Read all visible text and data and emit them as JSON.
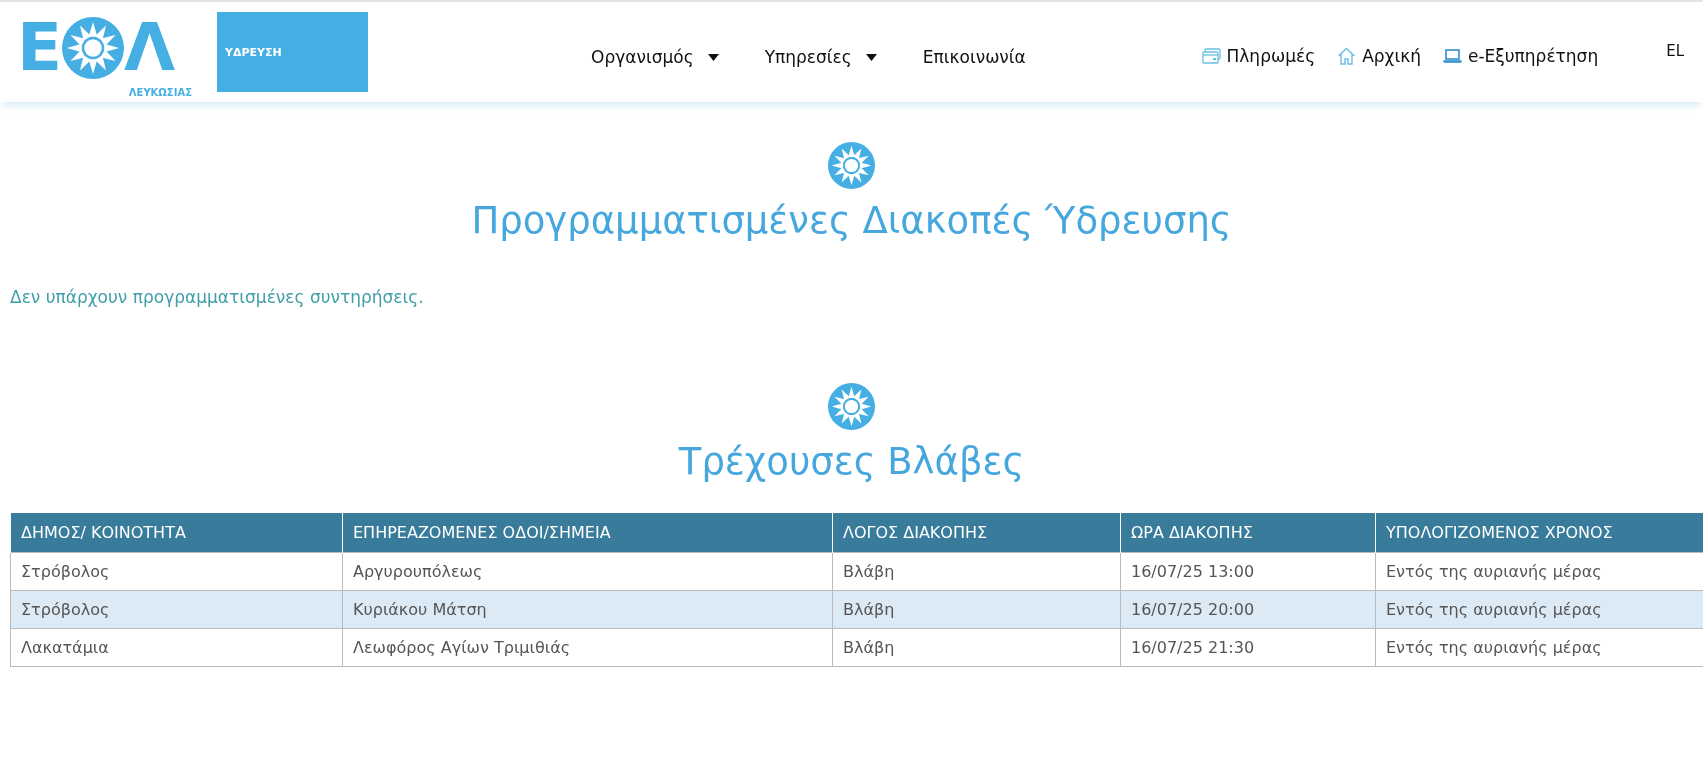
{
  "logo": {
    "letters": [
      "Ε",
      "Λ"
    ],
    "subtitle": "ΛΕΥΚΩΣΙΑΣ"
  },
  "section_badge": "ΥΔΡΕΥΣΗ",
  "nav": [
    {
      "label": "Οργανισμός",
      "dropdown": true
    },
    {
      "label": "Υπηρεσίες",
      "dropdown": true
    },
    {
      "label": "Επικοινωνία",
      "dropdown": false
    }
  ],
  "quick_links": [
    {
      "label": "Πληρωμές",
      "kind": "card"
    },
    {
      "label": "Αρχική",
      "kind": "home"
    },
    {
      "label": "e-Εξυπηρέτηση",
      "kind": "laptop"
    }
  ],
  "language": "EL",
  "planned": {
    "title": "Προγραμματισμένες Διακοπές Ύδρευσης",
    "message": "Δεν υπάρχουν προγραμματισμένες συντηρήσεις."
  },
  "faults": {
    "title": "Τρέχουσες Βλάβες",
    "table": {
      "columns": [
        "ΔΗΜΟΣ/ ΚΟΙΝΟΤΗΤΑ",
        "ΕΠΗΡΕΑΖΟΜΕΝΕΣ ΟΔΟΙ/ΣΗΜΕΙΑ",
        "ΛΟΓΟΣ ΔΙΑΚΟΠΗΣ",
        "ΩΡΑ ΔΙΑΚΟΠΗΣ",
        "ΥΠΟΛΟΓΙΖΟΜΕΝΟΣ ΧΡΟΝΟΣ"
      ],
      "rows": [
        [
          "Στρόβολος",
          "Αργυρουπόλεως",
          "Βλάβη",
          "16/07/25 13:00",
          "Εντός της αυριανής μέρας"
        ],
        [
          "Στρόβολος",
          "Κυριάκου Μάτση",
          "Βλάβη",
          "16/07/25 20:00",
          "Εντός της αυριανής μέρας"
        ],
        [
          "Λακατάμια",
          "Λεωφόρος Αγίων Τριμιθιάς",
          "Βλάβη",
          "16/07/25 21:30",
          "Εντός της αυριανής μέρας"
        ]
      ]
    }
  }
}
